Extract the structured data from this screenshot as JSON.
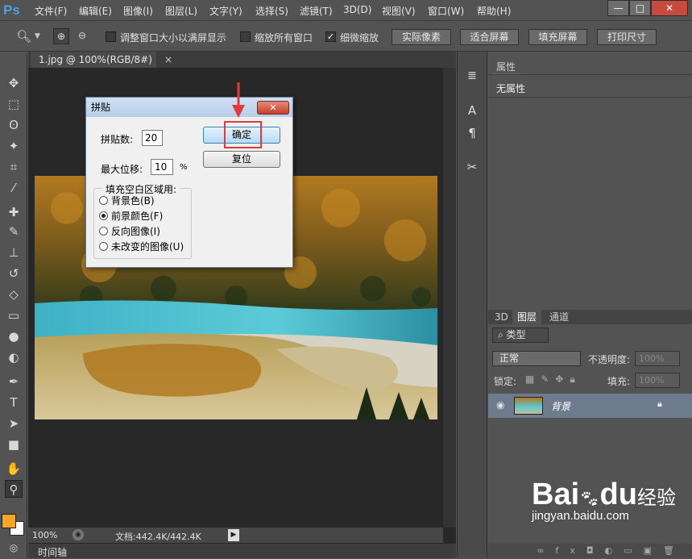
{
  "app": {
    "logo": "Ps"
  },
  "menu": [
    "文件(F)",
    "编辑(E)",
    "图像(I)",
    "图层(L)",
    "文字(Y)",
    "选择(S)",
    "滤镜(T)",
    "3D(D)",
    "视图(V)",
    "窗口(W)",
    "帮助(H)"
  ],
  "window_controls": {
    "minimize": "—",
    "maximize": "□",
    "close": "✕"
  },
  "options": {
    "resize_windows": "调整窗口大小以满屏显示",
    "zoom_all": "缩放所有窗口",
    "scrubby_zoom": "细微缩放",
    "actual_pixels": "实际像素",
    "fit_screen": "适合屏幕",
    "fill_screen": "填充屏幕",
    "print_size": "打印尺寸"
  },
  "document": {
    "tab_title": "1.jpg @ 100%(RGB/8#)",
    "zoom": "100%",
    "doc_size": "文档:442.4K/442.4K",
    "timeline": "时间轴"
  },
  "dialog": {
    "title": "拼贴",
    "tiles_label": "拼贴数:",
    "tiles_value": "20",
    "offset_label": "最大位移:",
    "offset_value": "10",
    "offset_unit": "%",
    "ok": "确定",
    "reset": "复位",
    "fill_group": "填充空白区域用:",
    "options": [
      "背景色(B)",
      "前景颜色(F)",
      "反向图像(I)",
      "未改变的图像(U)"
    ],
    "selected": 1
  },
  "properties": {
    "tab": "属性",
    "content": "无属性"
  },
  "layers_panel": {
    "tabs": [
      "3D",
      "图层",
      "通道"
    ],
    "kind": "类型",
    "blend_mode": "正常",
    "opacity_label": "不透明度:",
    "opacity_value": "100%",
    "lock_label": "锁定:",
    "fill_label": "填充:",
    "fill_value": "100%",
    "layer_name": "背景"
  },
  "watermark": {
    "brand": "Bai",
    "brand2": "du",
    "cn": "经验",
    "url": "jingyan.baidu.com"
  },
  "colors": {
    "accent": "#e03a3a",
    "foreground": "#f5a623",
    "ps_blue": "#4a9fe3"
  }
}
